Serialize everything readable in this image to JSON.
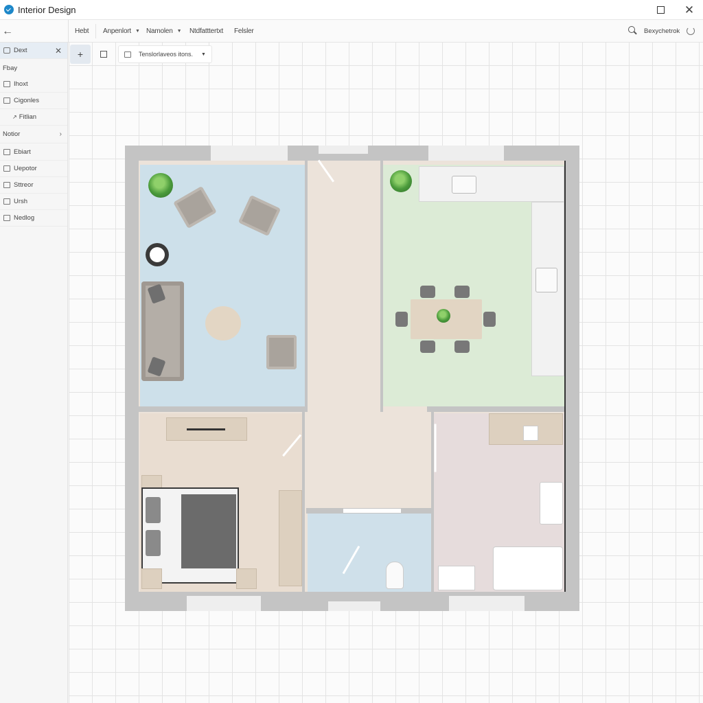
{
  "app": {
    "title": "Interior Design"
  },
  "toolbar": {
    "menus": [
      "Hebt",
      "Anpenlort",
      "Namolen",
      "Ntdfatttertxt",
      "Felsler"
    ],
    "search_label": "Bexychetrok"
  },
  "sidebar": {
    "items": [
      {
        "label": "Dext"
      },
      {
        "label": "Fbay"
      },
      {
        "label": "Ihoxt"
      },
      {
        "label": "Cigonles"
      },
      {
        "label": "Fitlian"
      },
      {
        "label": "Notior"
      },
      {
        "label": "Ebiart"
      },
      {
        "label": "Uepotor"
      },
      {
        "label": "Sttreor"
      },
      {
        "label": "Ursh"
      },
      {
        "label": "Nedlog"
      }
    ]
  },
  "canvas_tools": {
    "layer_label": "Tenslorlaveos itons."
  },
  "colors": {
    "accent": "#1e88c9",
    "living_room": "#cde0ea",
    "dining_room": "#dcebd6",
    "bathroom_room": "#e6dcdc",
    "hall_floor": "#ece1d6",
    "wall": "#c4c4c4"
  },
  "icons": [
    "check-circle-icon",
    "maximize-icon",
    "close-icon",
    "back-arrow-icon",
    "search-icon",
    "refresh-icon",
    "plus-icon",
    "square-icon",
    "calendar-icon"
  ]
}
